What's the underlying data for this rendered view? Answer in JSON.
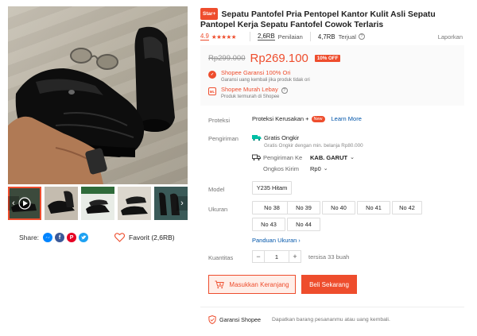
{
  "product": {
    "badge": "Star+",
    "title": "Sepatu Pantofel Pria Pentopel Kantor Kulit Asli Sepatu Pantopel Kerja Sepatu Fantofel Cowok Terlaris"
  },
  "stats": {
    "rating": "4.9",
    "stars": "★★★★★",
    "ratings_count": "2,6RB",
    "ratings_label": "Penilaian",
    "sold_count": "4,7RB",
    "sold_label": "Terjual",
    "report": "Laporkan"
  },
  "price": {
    "original": "Rp299.000",
    "current": "Rp269.100",
    "discount": "10% OFF"
  },
  "guarantees": [
    {
      "title": "Shopee Garansi 100% Ori",
      "subtitle": "Garansi uang kembali jika produk tidak ori"
    },
    {
      "title": "Shopee Murah Lebay",
      "subtitle": "Produk termurah di Shopee"
    }
  ],
  "protection": {
    "label": "Proteksi",
    "value": "Proteksi Kerusakan +",
    "badge": "New",
    "link": "Learn More"
  },
  "shipping": {
    "label": "Pengiriman",
    "free": "Gratis Ongkir",
    "free_note": "Gratis Ongkir dengan min. belanja Rp80.000",
    "to_label": "Pengiriman Ke",
    "to_value": "KAB. GARUT",
    "cost_label": "Ongkos Kirim",
    "cost_value": "Rp0"
  },
  "model": {
    "label": "Model",
    "options": [
      "Y235 Hitam"
    ]
  },
  "size": {
    "label": "Ukuran",
    "options": [
      "No 38",
      "No 39",
      "No 40",
      "No 41",
      "No 42",
      "No 43",
      "No 44"
    ],
    "guide": "Panduan Ukuran"
  },
  "quantity": {
    "label": "Kuantitas",
    "minus": "−",
    "value": "1",
    "plus": "+",
    "stock": "tersisa 33 buah"
  },
  "actions": {
    "cart": "Masukkan Keranjang",
    "buy": "Beli Sekarang"
  },
  "footer": {
    "guarantee": "Garansi Shopee",
    "desc": "Dapatkan barang pesananmu atau uang kembali."
  },
  "share": {
    "label": "Share:",
    "favorite": "Favorit (2,6RB)"
  },
  "colors": {
    "accent": "#ee4d2d",
    "link": "#0055aa",
    "messenger": "#0084ff",
    "facebook": "#3b5998",
    "pinterest": "#e60023",
    "twitter": "#1da1f2"
  }
}
